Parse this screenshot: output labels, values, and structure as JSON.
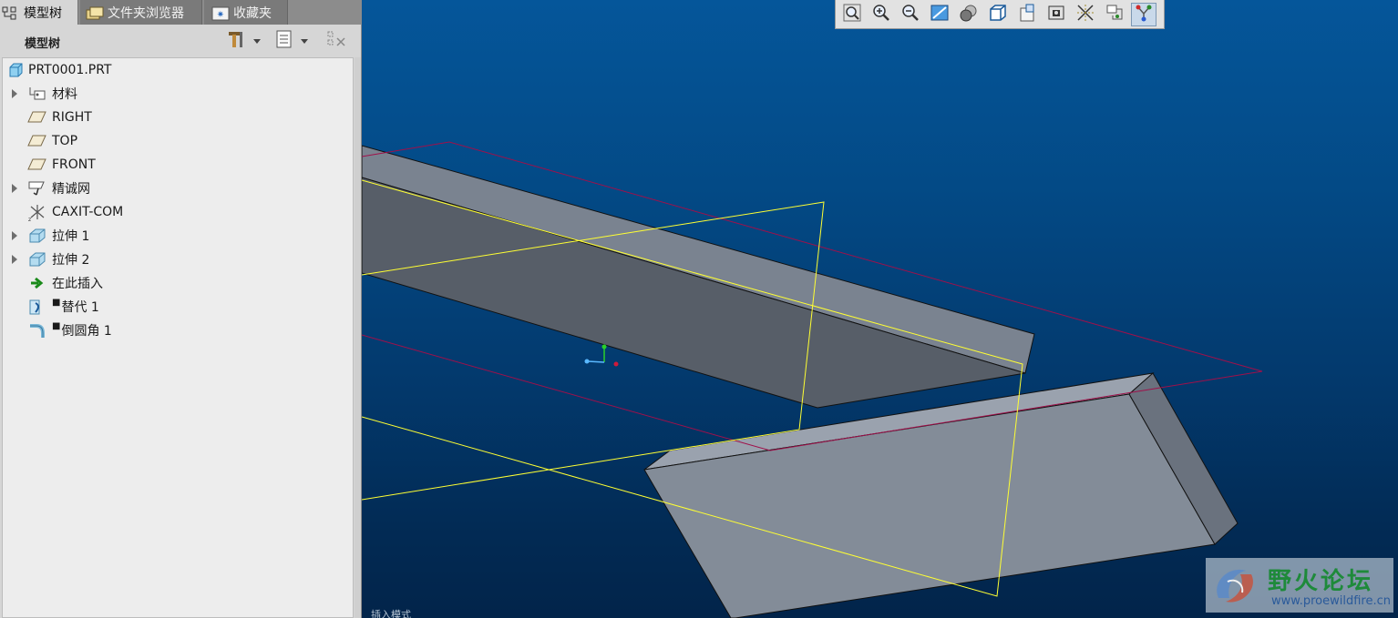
{
  "tabs": [
    {
      "label": "模型树",
      "icon": "model-tree-icon"
    },
    {
      "label": "文件夹浏览器",
      "icon": "folder-browser-icon"
    },
    {
      "label": "收藏夹",
      "icon": "favorites-icon"
    }
  ],
  "tree_header": {
    "title": "模型树"
  },
  "tree_items": [
    {
      "label": "PRT0001.PRT",
      "icon": "part-icon",
      "expandable": false
    },
    {
      "label": "材料",
      "icon": "material-icon",
      "expandable": true
    },
    {
      "label": "RIGHT",
      "icon": "datum-plane-icon",
      "expandable": false
    },
    {
      "label": "TOP",
      "icon": "datum-plane-icon",
      "expandable": false
    },
    {
      "label": "FRONT",
      "icon": "datum-plane-icon",
      "expandable": false
    },
    {
      "label": "精诚网",
      "icon": "mesh-icon",
      "expandable": true
    },
    {
      "label": "CAXIT-COM",
      "icon": "coordinate-system-icon",
      "expandable": false
    },
    {
      "label": "拉伸 1",
      "icon": "extrude-icon",
      "expandable": true
    },
    {
      "label": "拉伸 2",
      "icon": "extrude-icon",
      "expandable": true
    },
    {
      "label": "在此插入",
      "icon": "insert-here-arrow-icon",
      "expandable": false
    },
    {
      "label": "替代 1",
      "icon": "replace-icon",
      "expandable": false,
      "marked": true
    },
    {
      "label": "倒圆角 1",
      "icon": "round-icon",
      "expandable": false,
      "marked": true
    }
  ],
  "toolbar": [
    "zoom-fit-icon",
    "zoom-in-icon",
    "zoom-out-icon",
    "repaint-icon",
    "shading-icon",
    "saved-views-icon",
    "view-manager-icon",
    "display-style-icon",
    "datum-display-icon",
    "spin-center-icon",
    "annotation-display-icon"
  ],
  "watermark": {
    "text": "野火论坛",
    "url": "www.proewildfire.cn"
  },
  "status_text": "插入模式",
  "colors": {
    "viewport_top": "#05569a",
    "viewport_bottom": "#02244a",
    "datum_plane": "#ffff33",
    "datum_plane_2": "#a0104a",
    "solid_face": "#7c8490"
  }
}
